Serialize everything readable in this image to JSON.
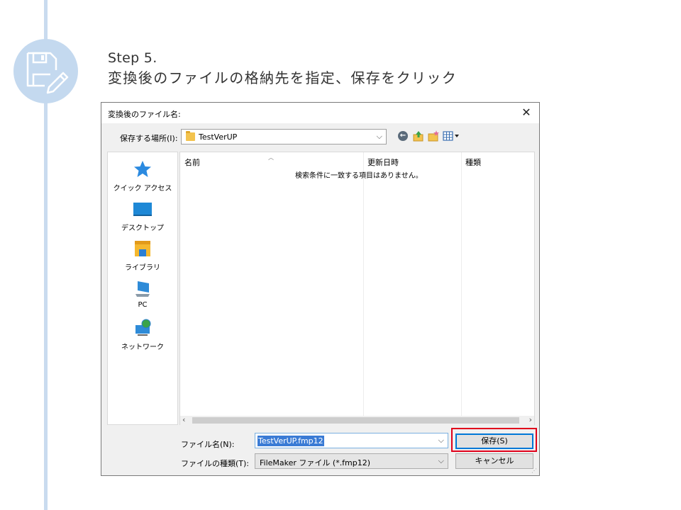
{
  "slide": {
    "step_title": "Step 5.",
    "step_description": "変換後のファイルの格納先を指定、保存をクリック",
    "step_icon": "save-edit-icon",
    "accent_color": "#c4d9ef"
  },
  "dialog": {
    "title": "変換後のファイル名:",
    "close_glyph": "✕",
    "location_label": "保存する場所(I):",
    "location_value": "TestVerUP",
    "sidebar": [
      {
        "label": "クイック アクセス",
        "icon": "star-icon"
      },
      {
        "label": "デスクトップ",
        "icon": "desktop-icon"
      },
      {
        "label": "ライブラリ",
        "icon": "library-folder-icon"
      },
      {
        "label": "PC",
        "icon": "pc-icon"
      },
      {
        "label": "ネットワーク",
        "icon": "network-icon"
      }
    ],
    "columns": {
      "name": "名前",
      "modified": "更新日時",
      "type": "種類"
    },
    "empty_message": "検索条件に一致する項目はありません。",
    "filename_label": "ファイル名(N):",
    "filename_value": "TestVerUP.fmp12",
    "filetype_label": "ファイルの種類(T):",
    "filetype_value": "FileMaker ファイル (*.fmp12)",
    "save_button": "保存(S)",
    "cancel_button": "キャンセル",
    "highlight_color": "#e0001b"
  }
}
